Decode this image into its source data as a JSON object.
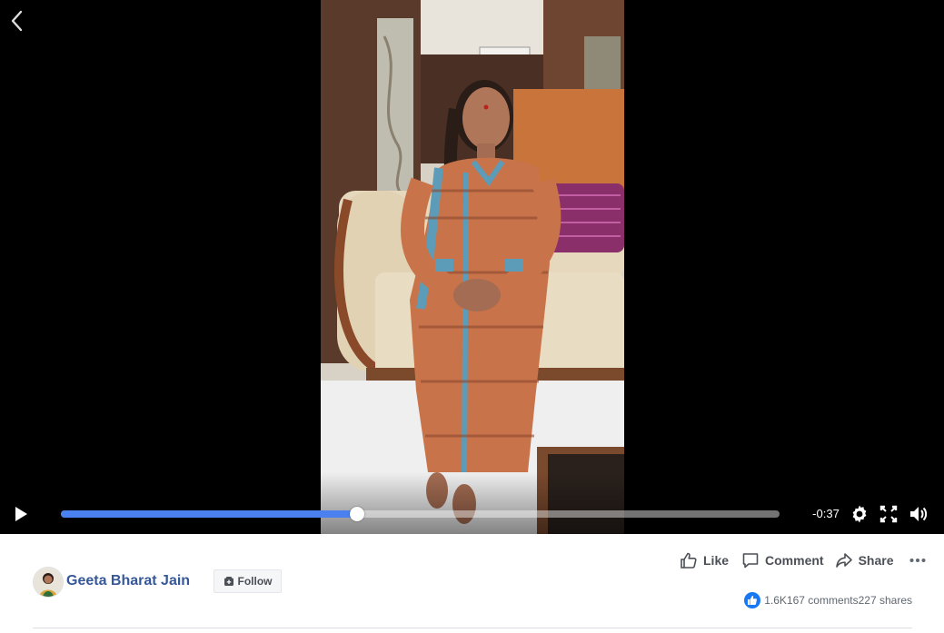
{
  "player": {
    "time_remaining": "-0:37",
    "progress": 0.412,
    "icons": {
      "back": "chevron-left-icon",
      "play": "play-icon",
      "settings": "gear-icon",
      "fullscreen": "fullscreen-icon",
      "volume": "volume-icon"
    }
  },
  "post": {
    "author": "Geeta Bharat Jain",
    "follow_label": "Follow",
    "actions": {
      "like": "Like",
      "comment": "Comment",
      "share": "Share"
    },
    "reaction_count": "1.6K",
    "comments": "167 comments",
    "shares": "227 shares"
  },
  "colors": {
    "progress": "#4a80f0",
    "author_link": "#365899",
    "like_badge": "#1877f2"
  }
}
